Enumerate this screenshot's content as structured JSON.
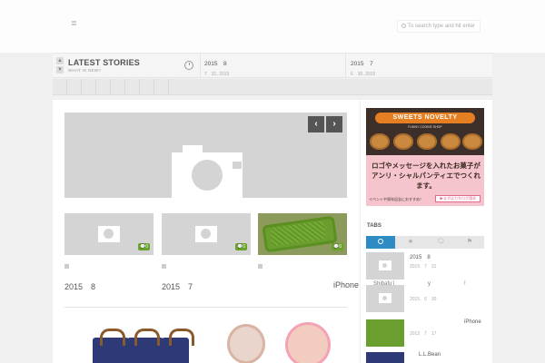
{
  "header": {
    "logo_glyph": "≣",
    "search_placeholder": "To search type and hit enter"
  },
  "stories": {
    "title": "LATEST STORIES",
    "subtitle": "WHAT IS NEW?",
    "items": [
      {
        "title": "2015　8",
        "date": "7　31, 2015"
      },
      {
        "title": "2015　7",
        "date": "6　30, 2015"
      }
    ]
  },
  "feature": {
    "prev": "‹",
    "next": "›"
  },
  "thumbs": [
    {
      "comments": "0",
      "title": "2015　8"
    },
    {
      "comments": "0",
      "title": "2015　7"
    },
    {
      "comments": "0",
      "title": "iPhone",
      "tag": "·"
    }
  ],
  "sidebar": {
    "ad": {
      "logo": "SWEETS NOVELTY",
      "shop": "FUNNY COOKIE SHOP",
      "text": "ロゴやメッセージを入れたお菓子がアンリ・シャルパンティエでつくれます。",
      "foot": "イベントや周年記念におすすめ！",
      "button": "▶まずはカタログ請求"
    },
    "tabs_title": "TABS",
    "recent": [
      {
        "title": "2015　8",
        "date": "2015　7　31"
      },
      {
        "title": "",
        "date": "2015　6　30",
        "overlay_left": "Shibafu’i",
        "overlay_mid": "y",
        "overlay_right": "!"
      },
      {
        "title": "iPhone",
        "date": "2013　7　17"
      },
      {
        "title": "L.L.Bean",
        "date": ""
      }
    ]
  }
}
